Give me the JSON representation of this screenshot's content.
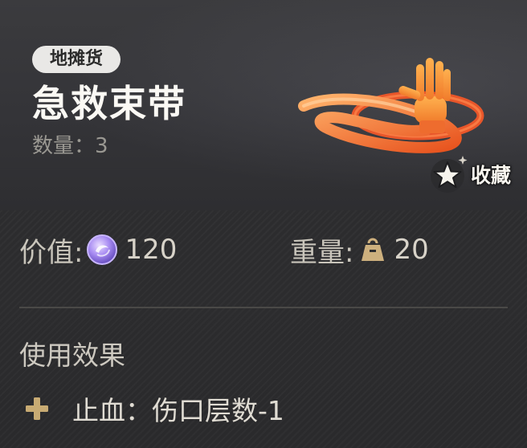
{
  "item": {
    "category": "地摊货",
    "name": "急救束带",
    "quantity_label": "数量：",
    "quantity": "3",
    "image_icon": "tourniquet-hand-icon",
    "favorite_label": "收藏"
  },
  "stats": {
    "value_label": "价值:",
    "value_icon": "currency-coin-icon",
    "value": "120",
    "weight_label": "重量:",
    "weight_icon": "weight-icon",
    "weight": "20"
  },
  "effects": {
    "title": "使用效果",
    "items": [
      {
        "icon": "plus-icon",
        "text": "止血：伤口层数-1"
      }
    ]
  },
  "colors": {
    "background": "#2c2c2e",
    "accent_gold": "#c8ab73",
    "text_primary": "#fbf9f4",
    "text_secondary": "#9a9892",
    "item_orange": "#f07a3a"
  }
}
